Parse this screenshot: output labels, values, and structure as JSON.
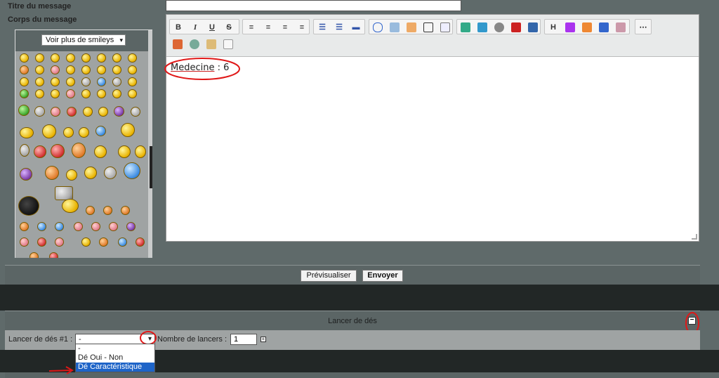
{
  "form": {
    "title_label": "Titre du message",
    "body_label": "Corps du message",
    "title_value": ""
  },
  "smileys": {
    "more_label": "Voir plus de smileys"
  },
  "editor": {
    "content_word": "Medecine",
    "content_rest": " : 6",
    "toolbar_row1": [
      "B",
      "I",
      "U",
      "S"
    ],
    "heading_btn": "H",
    "more_btn": "⋯"
  },
  "buttons": {
    "preview": "Prévisualiser",
    "send": "Envoyer"
  },
  "dice": {
    "section_title": "Lancer de dés",
    "collapse_label": "−",
    "row_label": "Lancer de dés #1 :",
    "selected": "-",
    "count_label": "Nombre de lancers :",
    "count_value": "1",
    "add_label": "+",
    "options": [
      "-",
      "Dé Oui - Non",
      "Dé Caractéristique"
    ]
  },
  "colors": {
    "annotation_red": "#e01818",
    "selection_blue": "#1e64c8"
  }
}
